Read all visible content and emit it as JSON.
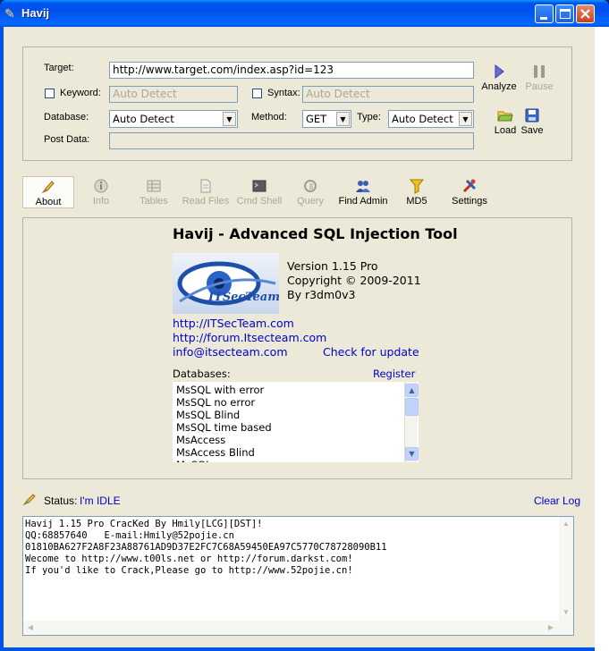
{
  "window": {
    "title": "Havij"
  },
  "form": {
    "target_label": "Target:",
    "target_value": "http://www.target.com/index.asp?id=123",
    "keyword_label": "Keyword:",
    "keyword_placeholder": "Auto Detect",
    "syntax_label": "Syntax:",
    "syntax_placeholder": "Auto Detect",
    "database_label": "Database:",
    "database_value": "Auto Detect",
    "method_label": "Method:",
    "method_value": "GET",
    "type_label": "Type:",
    "type_value": "Auto Detect",
    "postdata_label": "Post Data:"
  },
  "actions": {
    "analyze": "Analyze",
    "pause": "Pause",
    "load": "Load",
    "save": "Save"
  },
  "toolbar": [
    {
      "label": "About",
      "icon": "pen-icon"
    },
    {
      "label": "Info",
      "icon": "info-icon"
    },
    {
      "label": "Tables",
      "icon": "tables-icon"
    },
    {
      "label": "Read Files",
      "icon": "file-icon"
    },
    {
      "label": "Cmd Shell",
      "icon": "terminal-icon"
    },
    {
      "label": "Query",
      "icon": "query-icon"
    },
    {
      "label": "Find Admin",
      "icon": "admin-icon"
    },
    {
      "label": "MD5",
      "icon": "md5-icon"
    },
    {
      "label": "Settings",
      "icon": "settings-icon"
    }
  ],
  "about": {
    "heading": "Havij - Advanced SQL Injection Tool",
    "version": "Version 1.15 Pro",
    "copyright": "Copyright © 2009-2011",
    "author": "By r3dm0v3",
    "link1": "http://ITSecTeam.com",
    "link2": "http://forum.Itsecteam.com",
    "email": "info@itsecteam.com",
    "update": "Check for update",
    "databases_label": "Databases:",
    "register": "Register",
    "databases": [
      "MsSQL with error",
      "MsSQL no error",
      "MsSQL Blind",
      "MsSQL time based",
      "MsAccess",
      "MsAccess Blind",
      "MySQL"
    ],
    "logo_text": "ITSecTeam"
  },
  "status": {
    "label": "Status:",
    "value": "I'm IDLE",
    "clear_log": "Clear Log"
  },
  "log": {
    "lines": [
      "Havij 1.15 Pro CracKed By Hmily[LCG][DST]!",
      "QQ:68857640   E-mail:Hmily@52pojie.cn",
      "01810BA627F2A8F23A88761AD9D37E2FC7C68A59450EA97C5770C78728090B11",
      "Wecome to http://www.t00ls.net or http://forum.darkst.com!",
      "If you'd like to Crack,Please go to http://www.52pojie.cn!"
    ]
  },
  "colors": {
    "titlebar": "#0054e3",
    "face": "#ece9d8",
    "link": "#0000c8",
    "status_value": "#0000c8"
  }
}
